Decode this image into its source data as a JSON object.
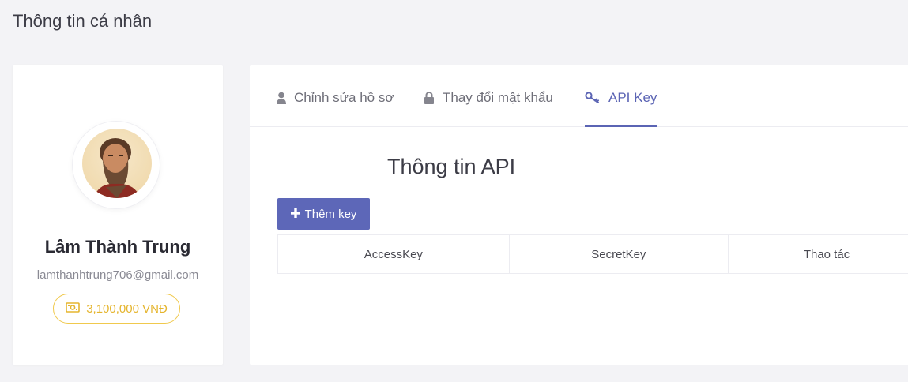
{
  "page": {
    "title": "Thông tin cá nhân"
  },
  "profile": {
    "name": "Lâm Thành Trung",
    "email": "lamthanhtrung706@gmail.com",
    "balance": "3,100,000 VNĐ",
    "avatar_icon": "user-avatar-photo",
    "balance_icon": "money-bill-icon"
  },
  "tabs": [
    {
      "label": "Chỉnh sửa hồ sơ",
      "icon": "user-icon",
      "active": false
    },
    {
      "label": "Thay đổi mật khẩu",
      "icon": "lock-icon",
      "active": false
    },
    {
      "label": "API Key",
      "icon": "key-icon",
      "active": true
    }
  ],
  "api": {
    "title": "Thông tin API",
    "add_button_label": "Thêm key",
    "columns": [
      "AccessKey",
      "SecretKey",
      "Thao tác"
    ]
  },
  "colors": {
    "accent": "#5d67b8",
    "balance": "#e5b52e",
    "background": "#f3f3f6"
  }
}
